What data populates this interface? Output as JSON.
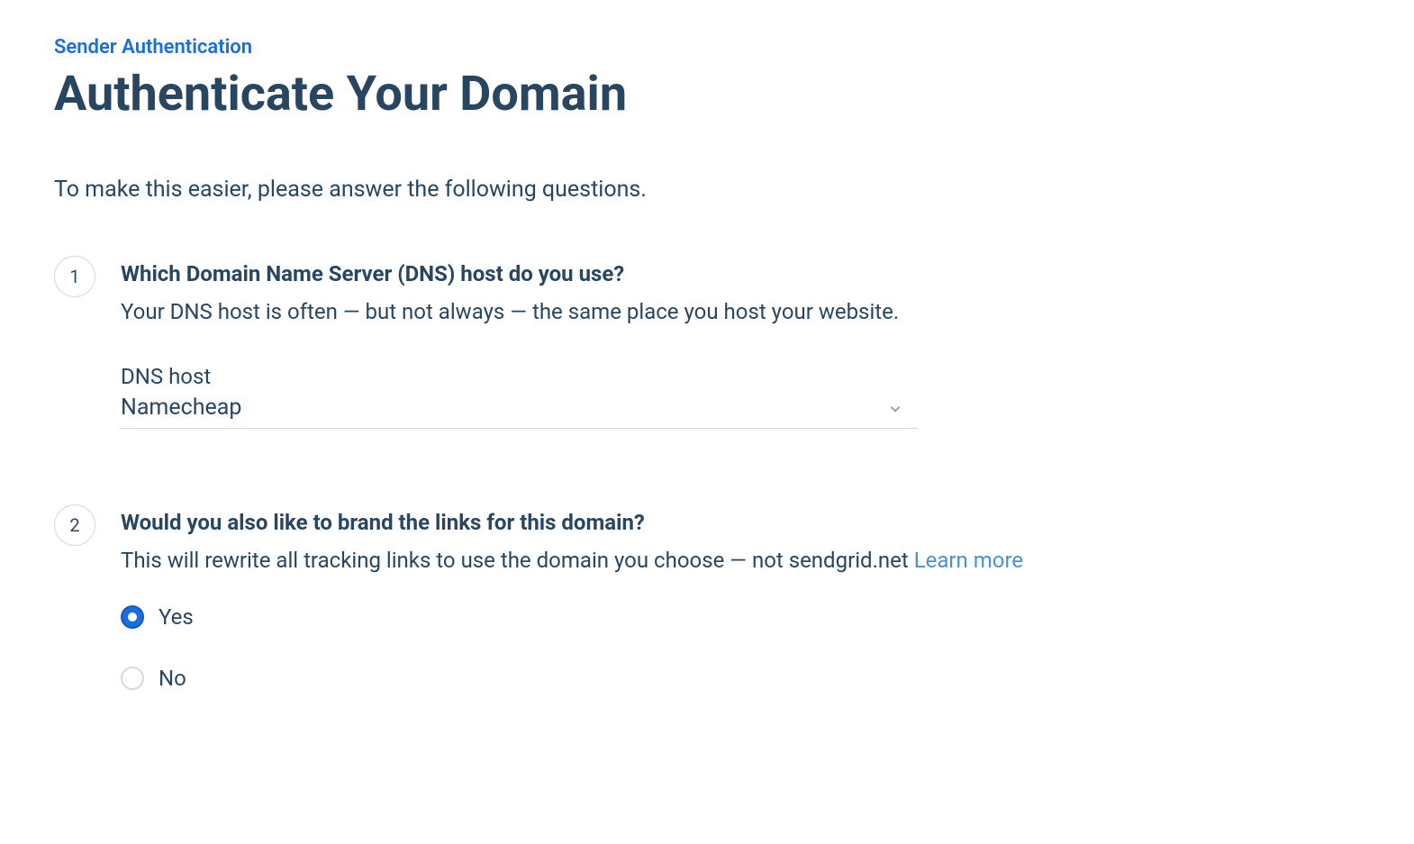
{
  "breadcrumb": {
    "label": "Sender Authentication"
  },
  "page": {
    "title": "Authenticate Your Domain",
    "intro": "To make this easier, please answer the following questions."
  },
  "questions": [
    {
      "number": "1",
      "title": "Which Domain Name Server (DNS) host do you use?",
      "description": "Your DNS host is often — but not always — the same place you host your website.",
      "field_label": "DNS host",
      "select_value": "Namecheap"
    },
    {
      "number": "2",
      "title": "Would you also like to brand the links for this domain?",
      "description_prefix": "This will rewrite all tracking links to use the domain you choose — not sendgrid.net ",
      "learn_more": "Learn more",
      "options": [
        {
          "label": "Yes",
          "checked": true
        },
        {
          "label": "No",
          "checked": false
        }
      ]
    }
  ]
}
